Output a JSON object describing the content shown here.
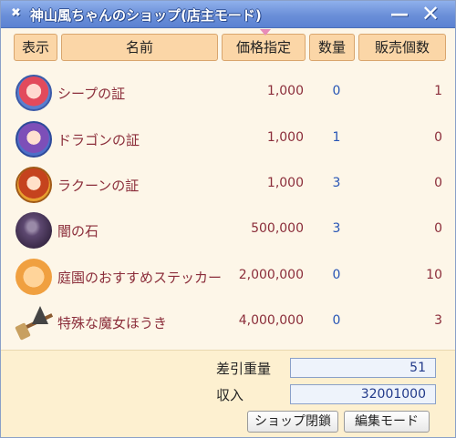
{
  "window": {
    "title": "神山風ちゃんのショップ(店主モード)",
    "minimize_symbol": "—",
    "close_symbol": "✕"
  },
  "header": {
    "display": "表示",
    "name": "名前",
    "price": "価格指定",
    "qty": "数量",
    "sold": "販売個数"
  },
  "items": [
    {
      "icon": "girl-red-hair-portrait-icon",
      "name": "シープの証",
      "price": "1,000",
      "qty": "0",
      "sold": "1"
    },
    {
      "icon": "girl-purple-hair-portrait-icon",
      "name": "ドラゴンの証",
      "price": "1,000",
      "qty": "1",
      "sold": "0"
    },
    {
      "icon": "girl-orange-hair-portrait-icon",
      "name": "ラクーンの証",
      "price": "1,000",
      "qty": "3",
      "sold": "0"
    },
    {
      "icon": "dark-stone-icon",
      "name": "闇の石",
      "price": "500,000",
      "qty": "3",
      "sold": "0"
    },
    {
      "icon": "sticker-icon",
      "name": "庭園のおすすめステッカー",
      "price": "2,000,000",
      "qty": "0",
      "sold": "10"
    },
    {
      "icon": "witch-broom-icon",
      "name": "特殊な魔女ほうき",
      "price": "4,000,000",
      "qty": "0",
      "sold": "3"
    }
  ],
  "footer": {
    "weight_label": "差引重量",
    "weight_value": "51",
    "income_label": "収入",
    "income_value": "32001000",
    "close_shop_label": "ショップ閉鎖",
    "edit_mode_label": "編集モード"
  },
  "colors": {
    "title_bar": "#6a8fd8",
    "header_cell": "#fbd6a7",
    "name_text": "#8b2d3a",
    "qty_text": "#2855b5"
  }
}
